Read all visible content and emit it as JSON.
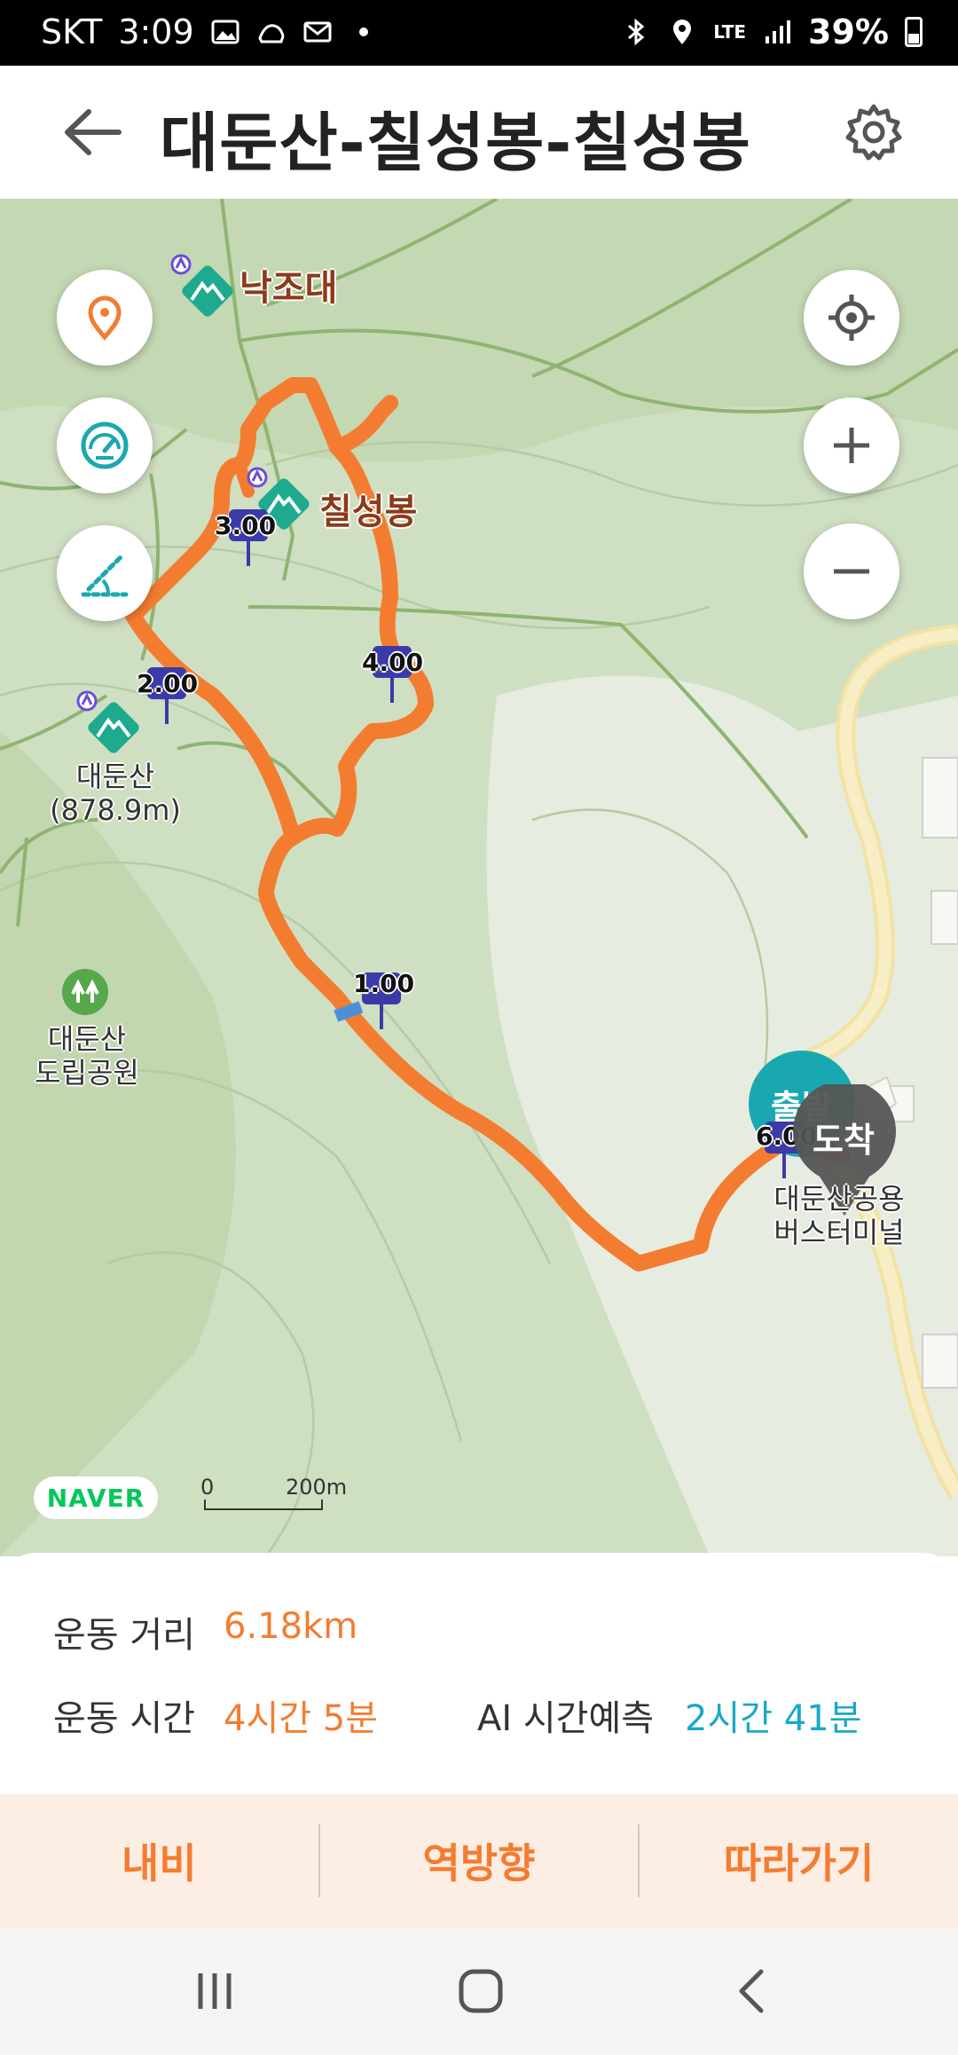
{
  "status_bar": {
    "carrier": "SKT",
    "time": "3:09",
    "network": "LTE",
    "battery": "39%",
    "icons": [
      "gallery-icon",
      "shoe-icon",
      "mail-icon",
      "dot-icon",
      "bluetooth-icon",
      "location-icon",
      "signal-icon",
      "battery-icon"
    ]
  },
  "header": {
    "title": "대둔산-칠성봉-칠성봉",
    "back_icon": "back-arrow-icon",
    "settings_icon": "gear-icon"
  },
  "map": {
    "left_buttons": [
      "location-pin-icon",
      "speedometer-icon",
      "slope-icon"
    ],
    "right_buttons": [
      "my-location-icon",
      "zoom-in-icon",
      "zoom-out-icon"
    ],
    "pois": [
      {
        "name": "낙조대"
      },
      {
        "name": "칠성봉"
      },
      {
        "name": "대둔산",
        "sub": "(878.9m)"
      },
      {
        "name": "대둔산\n도립공원"
      },
      {
        "name": "대둔산공용\n버스터미널"
      }
    ],
    "km_markers": [
      "1.00",
      "2.00",
      "3.00",
      "4.00",
      "6.00"
    ],
    "start_label": "출발",
    "end_label": "도착",
    "provider": "NAVER",
    "scale": {
      "start": "0",
      "end": "200m"
    },
    "colors": {
      "route": "#f47c30",
      "mountain_marker": "#1eaa8e",
      "start": "#1aa8b0",
      "end": "#555555",
      "km_marker": "#3a3aa8"
    }
  },
  "info": {
    "distance_label": "운동 거리",
    "distance_value": "6.18km",
    "time_label": "운동 시간",
    "time_value": "4시간 5분",
    "ai_label": "AI 시간예측",
    "ai_value": "2시간 41분",
    "colors": {
      "value": "#f47c30",
      "ai": "#1aa8c8"
    }
  },
  "actions": {
    "navi": "내비",
    "reverse": "역방향",
    "follow": "따라가기"
  },
  "navbar": {
    "icons": [
      "recent-apps-icon",
      "home-icon",
      "nav-back-icon"
    ]
  }
}
